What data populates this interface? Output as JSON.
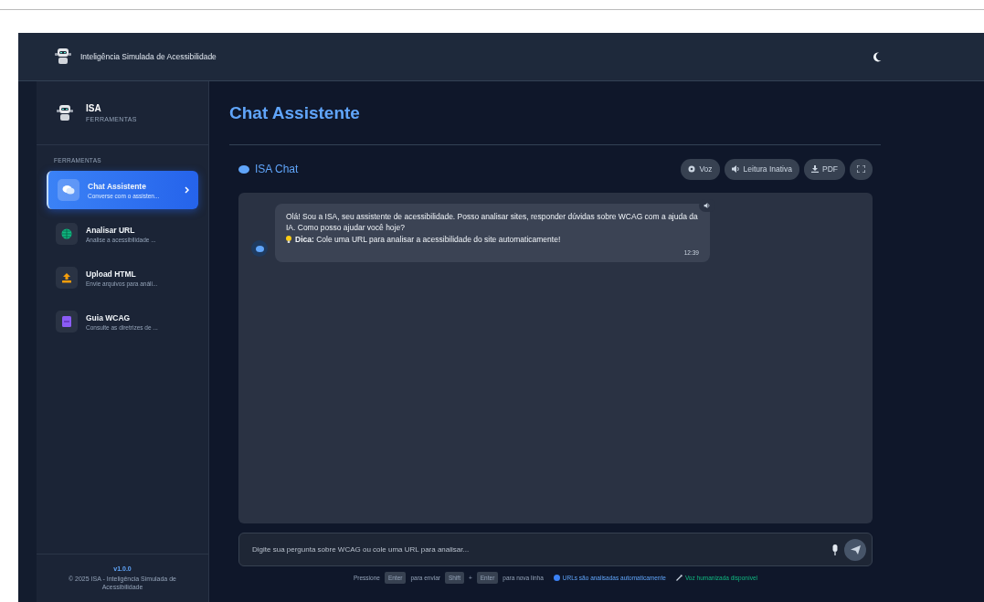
{
  "header": {
    "title": "Inteligência Simulada de Acessibilidade"
  },
  "sidebar": {
    "brand": "ISA",
    "brand_subtitle": "FERRAMENTAS",
    "section_label": "FERRAMENTAS",
    "items": [
      {
        "kind": "chat",
        "title": "Chat Assistente",
        "subtitle": "Converse com o assisten...",
        "selected": true
      },
      {
        "kind": "url",
        "title": "Analisar URL",
        "subtitle": "Analise a acessibilidade ...",
        "selected": false
      },
      {
        "kind": "upload",
        "title": "Upload HTML",
        "subtitle": "Envie arquivos para análi...",
        "selected": false
      },
      {
        "kind": "guide",
        "title": "Guia WCAG",
        "subtitle": "Consulte as diretrizes de ...",
        "selected": false
      }
    ],
    "version": "v1.0.0",
    "copyright": "© 2025 ISA - Inteligência Simulada de Acessibilidade"
  },
  "main": {
    "title": "Chat Assistente",
    "chat_title": "ISA Chat",
    "toolbar": [
      {
        "kind": "voice",
        "label": "Voz"
      },
      {
        "kind": "reading",
        "label": "Leitura Inativa"
      },
      {
        "kind": "pdf",
        "label": "PDF"
      },
      {
        "kind": "fullscreen"
      }
    ],
    "messages": [
      {
        "text": "Olá! Sou a ISA, seu assistente de acessibilidade. Posso analisar sites, responder dúvidas sobre WCAG com a ajuda da IA. Como posso ajudar você hoje?",
        "tip": "**Dica:** Cole uma URL para analisar a acessibilidade do site automaticamente!",
        "time": "12:39"
      }
    ],
    "input": {
      "placeholder": "Digite sua pergunta sobre WCAG ou cole uma URL para analisar..."
    },
    "hints": [
      {
        "kind": "text",
        "text": "Pressione"
      },
      {
        "kind": "key",
        "text": "Enter"
      },
      {
        "kind": "text",
        "text": "para enviar"
      },
      {
        "kind": "key",
        "text": "Shift"
      },
      {
        "kind": "text",
        "text": "+"
      },
      {
        "kind": "key",
        "text": "Enter"
      },
      {
        "kind": "text",
        "text": "para nova linha"
      },
      {
        "kind": "info",
        "text": "URLs são analisadas automaticamente"
      },
      {
        "kind": "voice",
        "text": "Voz humanizada disponível"
      }
    ]
  }
}
